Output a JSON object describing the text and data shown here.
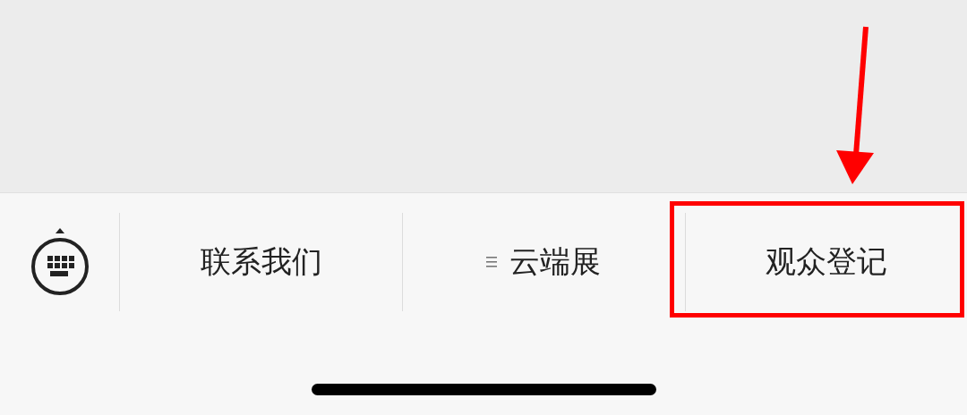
{
  "menu_bar": {
    "items": [
      {
        "label": "联系我们",
        "kind": "plain",
        "highlighted": false
      },
      {
        "label": "云端展",
        "kind": "submenu",
        "highlighted": false
      },
      {
        "label": "观众登记",
        "kind": "plain",
        "highlighted": true
      }
    ]
  }
}
